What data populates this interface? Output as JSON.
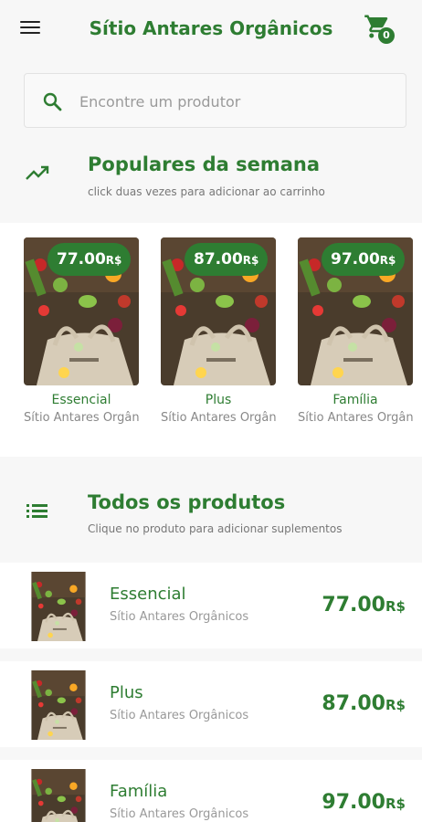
{
  "header": {
    "title": "Sítio Antares Orgânicos",
    "cart_count": "0"
  },
  "search": {
    "placeholder": "Encontre um produtor"
  },
  "popular": {
    "title": "Populares da semana",
    "subtitle": "click duas vezes para adicionar ao carrinho",
    "items": [
      {
        "price": "77.00",
        "currency": "R$",
        "name": "Essencial",
        "store": "Sítio Antares Orgânicos"
      },
      {
        "price": "87.00",
        "currency": "R$",
        "name": "Plus",
        "store": "Sítio Antares Orgânicos"
      },
      {
        "price": "97.00",
        "currency": "R$",
        "name": "Família",
        "store": "Sítio Antares Orgânicos"
      }
    ]
  },
  "all_products": {
    "title": "Todos os produtos",
    "subtitle": "Clique no produto para adicionar suplementos",
    "items": [
      {
        "name": "Essencial",
        "store": "Sítio Antares Orgânicos",
        "price": "77.00",
        "currency": "R$"
      },
      {
        "name": "Plus",
        "store": "Sítio Antares Orgânicos",
        "price": "87.00",
        "currency": "R$"
      },
      {
        "name": "Família",
        "store": "Sítio Antares Orgânicos",
        "price": "97.00",
        "currency": "R$"
      }
    ]
  },
  "colors": {
    "accent": "#2e7d32",
    "background": "#f7f7f7"
  },
  "icons": [
    "menu-icon",
    "cart-icon",
    "search-icon",
    "trending-up-icon",
    "list-icon",
    "produce-bag-image"
  ]
}
